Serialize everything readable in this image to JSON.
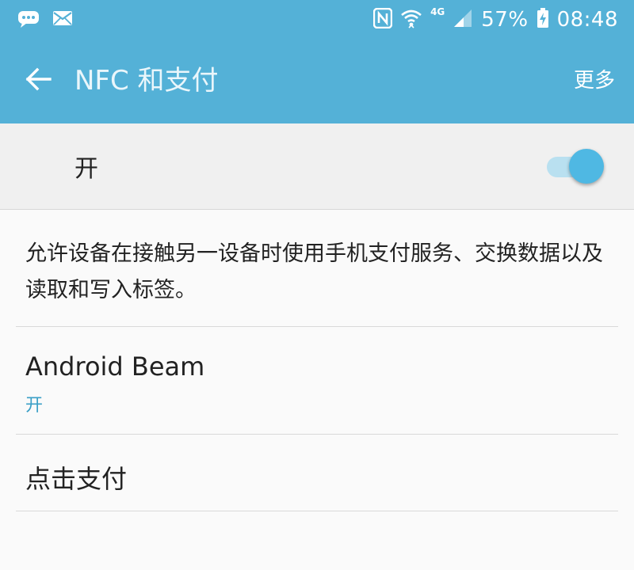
{
  "status_bar": {
    "battery_percent": "57%",
    "time": "08:48",
    "network_type": "4G",
    "icons": [
      "chat-bubble-icon",
      "mail-icon",
      "nfc-icon",
      "wifi-icon",
      "signal-icon",
      "battery-charging-icon"
    ]
  },
  "toolbar": {
    "title": "NFC 和支付",
    "more_label": "更多"
  },
  "master_switch": {
    "label": "开",
    "on": true
  },
  "description": "允许设备在接触另一设备时使用手机支付服务、交换数据以及读取和写入标签。",
  "items": [
    {
      "title": "Android Beam",
      "subtitle": "开"
    },
    {
      "title": "点击支付"
    }
  ],
  "colors": {
    "appbar": "#54b1d7",
    "accent": "#4fb8e3",
    "subtitle": "#3a9fc7"
  }
}
